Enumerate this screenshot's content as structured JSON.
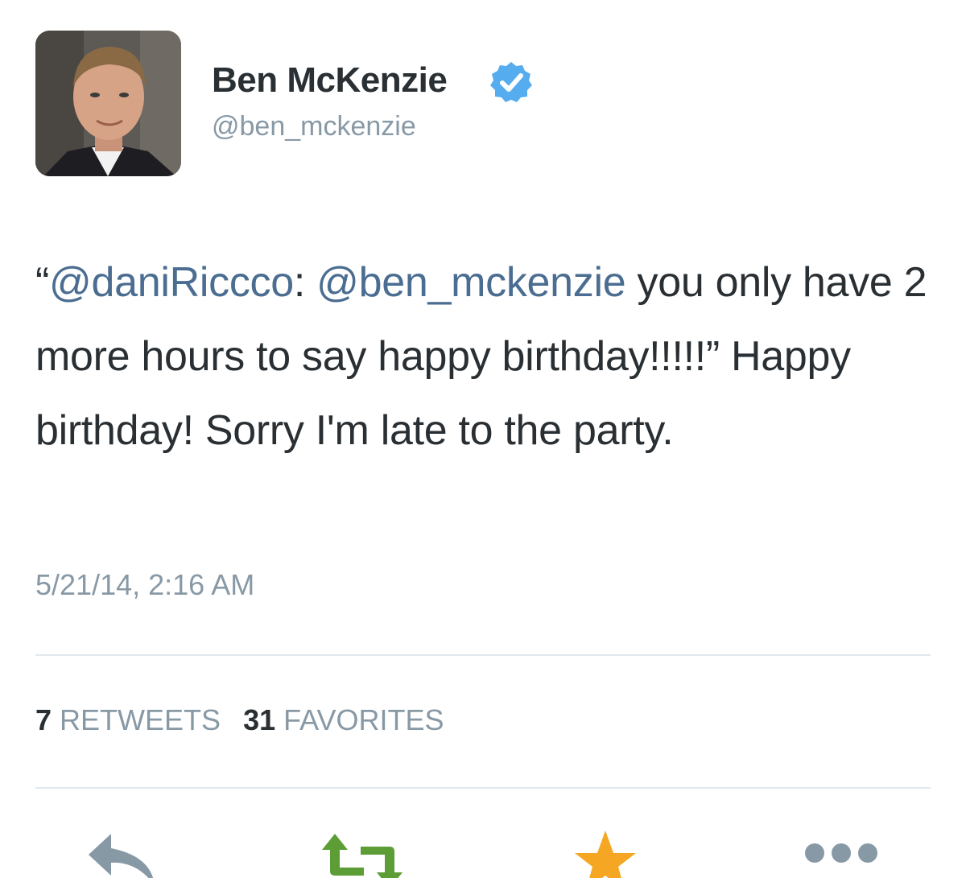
{
  "tweet": {
    "author": {
      "display_name": "Ben McKenzie",
      "handle": "@ben_mckenzie",
      "verified": true
    },
    "text": {
      "open_quote": "“",
      "mention_1": "@daniRiccco",
      "colon": ": ",
      "mention_2": "@ben_mckenzie",
      "body": " you only have 2 more hours to say happy birthday!!!!!” Happy birthday! Sorry I'm late to the party."
    },
    "timestamp": "5/21/14, 2:16 AM",
    "stats": {
      "retweets_count": "7",
      "retweets_label": "RETWEETS",
      "favorites_count": "31",
      "favorites_label": "FAVORITES"
    }
  },
  "actions": [
    {
      "name": "reply",
      "icon": "reply-icon"
    },
    {
      "name": "retweet",
      "icon": "retweet-icon"
    },
    {
      "name": "favorite",
      "icon": "star-icon"
    },
    {
      "name": "more",
      "icon": "more-icon"
    }
  ],
  "colors": {
    "text": "#292f33",
    "muted": "#8899a6",
    "mention": "#4a6d91",
    "verified": "#55acee",
    "retweet": "#5c9d35",
    "favorite": "#f5a623",
    "action_gray": "#8899a6"
  }
}
